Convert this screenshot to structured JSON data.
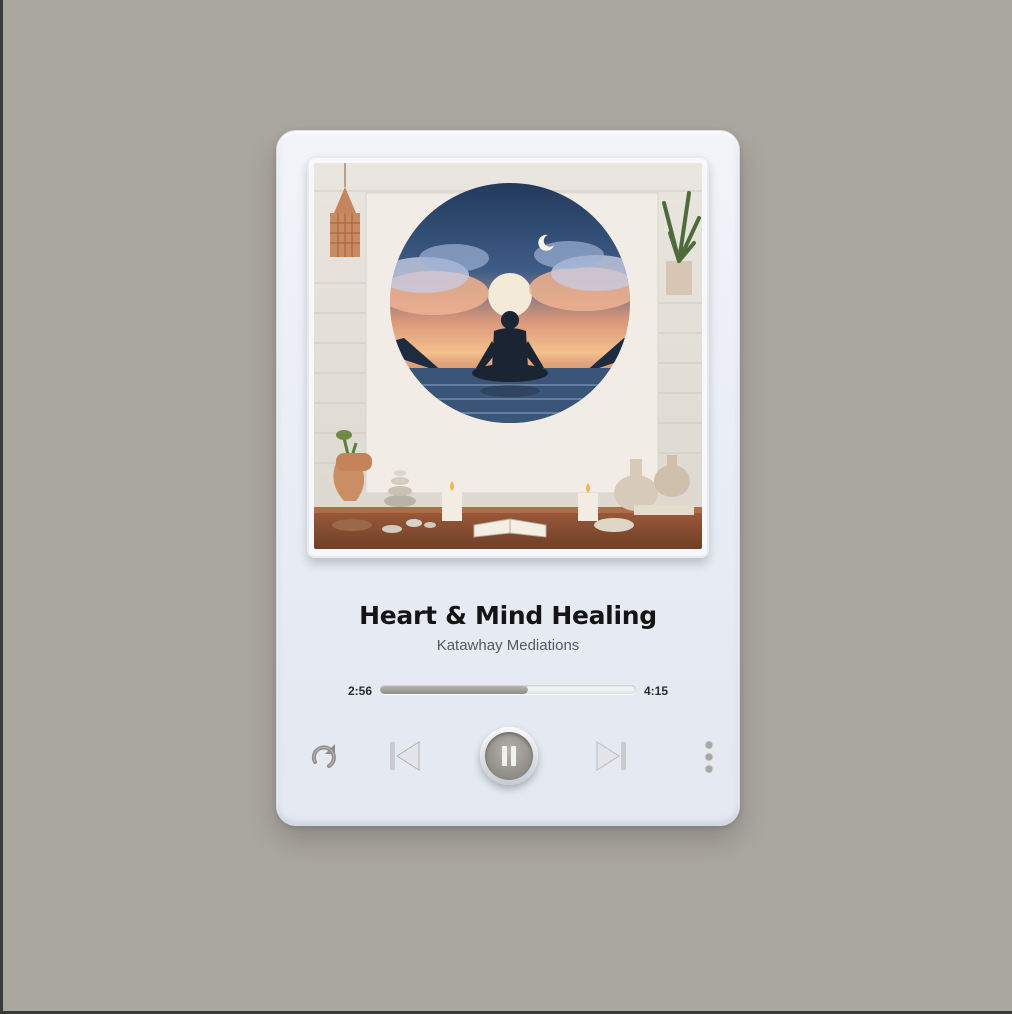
{
  "player": {
    "track_title": "Heart & Mind Healing",
    "artist": "Katawhay Mediations",
    "elapsed": "2:56",
    "duration": "4:15",
    "progress_fraction": 0.58
  },
  "controls": {
    "repeat_icon": "repeat-icon",
    "previous_icon": "skip-previous-icon",
    "play_state_icon": "pause-icon",
    "next_icon": "skip-next-icon",
    "more_icon": "more-vertical-icon"
  },
  "colors": {
    "background": "#aaa79f",
    "card": "#eef1f7",
    "accent": "#8f8d85"
  }
}
